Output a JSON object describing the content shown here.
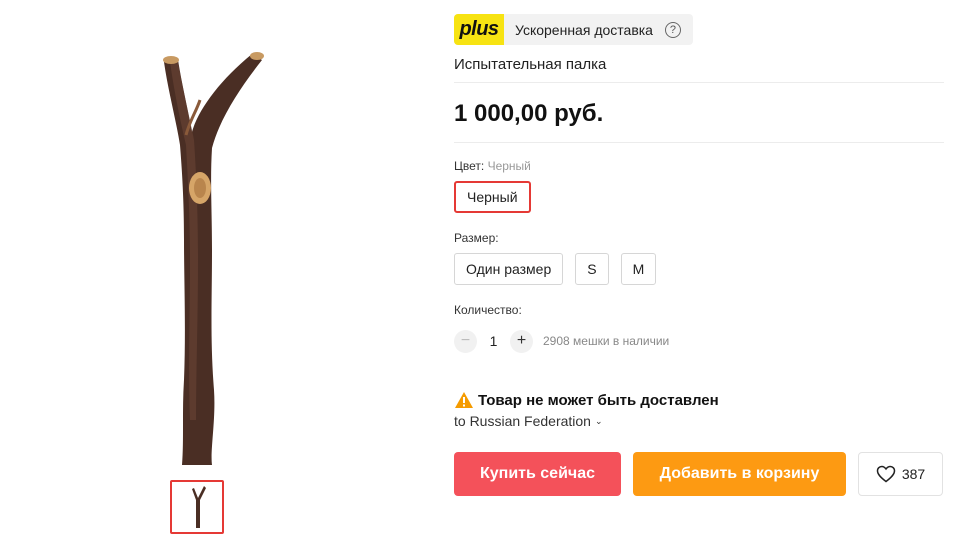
{
  "gallery": {
    "main_image_alt": "walking-stick-photo",
    "thumbnail_selected": true
  },
  "plus": {
    "badge": "plus",
    "text": "Ускоренная доставка",
    "help": "?"
  },
  "product": {
    "title": "Испытательная палка",
    "price": "1 000,00 руб."
  },
  "color": {
    "label": "Цвет:",
    "value": "Черный",
    "options": [
      "Черный"
    ]
  },
  "size": {
    "label": "Размер:",
    "options": [
      "Один размер",
      "S",
      "M"
    ]
  },
  "quantity": {
    "label": "Количество:",
    "minus": "−",
    "value": "1",
    "plus": "+",
    "stock": "2908 мешки в наличии"
  },
  "shipping": {
    "warning": "Товар не может быть доставлен",
    "destination": "to Russian Federation",
    "chevron": "⌄"
  },
  "actions": {
    "buy_now": "Купить сейчас",
    "add_to_cart": "Добавить в корзину",
    "wishlist_count": "387"
  },
  "colors": {
    "buy": "#f4515a",
    "cart": "#fd9a12",
    "plus_badge": "#f7e312",
    "selected_border": "#e53935"
  }
}
